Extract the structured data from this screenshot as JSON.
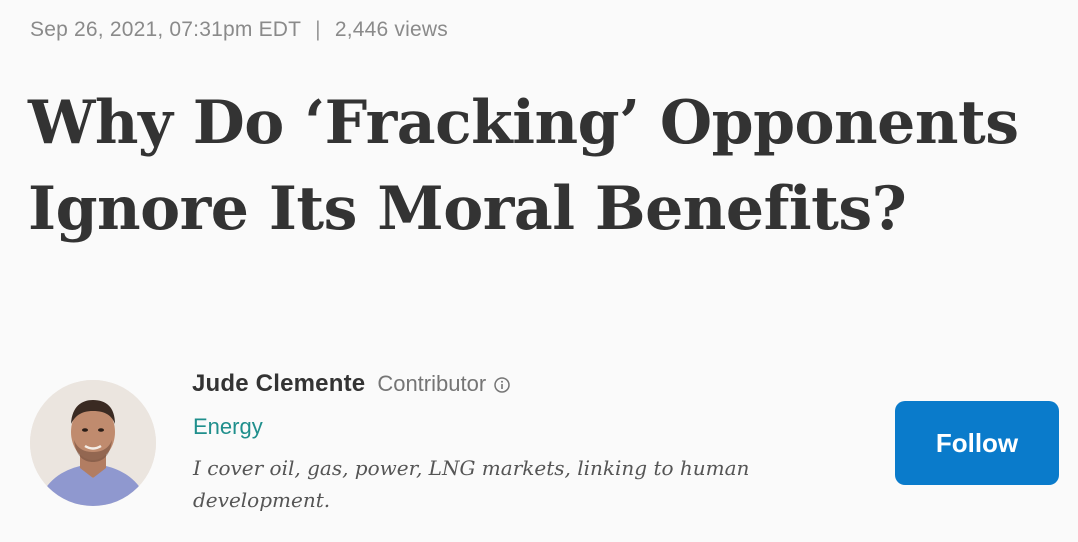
{
  "meta": {
    "date": "Sep 26, 2021, 07:31pm EDT",
    "separator": "|",
    "views": "2,446 views"
  },
  "article": {
    "title": "Why Do ‘Fracking’ Opponents Ignore Its Moral Benefits?"
  },
  "author": {
    "name": "Jude Clemente",
    "role": "Contributor",
    "info_icon": "info-circle-icon",
    "channel": "Energy",
    "bio": "I cover oil, gas, power, LNG markets, linking to human development."
  },
  "actions": {
    "follow_label": "Follow"
  },
  "colors": {
    "accent": "#0a7bcb",
    "channel": "#1f8f8c",
    "headline": "#333333",
    "meta": "#8a8a8a"
  }
}
